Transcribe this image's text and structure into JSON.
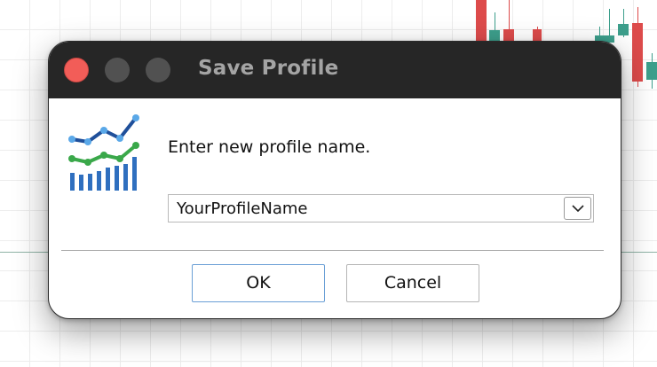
{
  "window": {
    "title": "Save Profile"
  },
  "dialog": {
    "prompt": "Enter new profile name.",
    "profile_name_value": "YourProfileName",
    "ok_label": "OK",
    "cancel_label": "Cancel"
  },
  "icons": {
    "app": "chart-icon",
    "dropdown": "chevron-down-icon"
  },
  "colors": {
    "titlebar": "#262626",
    "close_button": "#f25d58",
    "inactive_window_button": "#515151",
    "title_text": "#a4a4a4",
    "ok_focus_border": "#6a9fd6",
    "candle_up": "#3d9f8c",
    "candle_down": "#dd4b4b"
  }
}
